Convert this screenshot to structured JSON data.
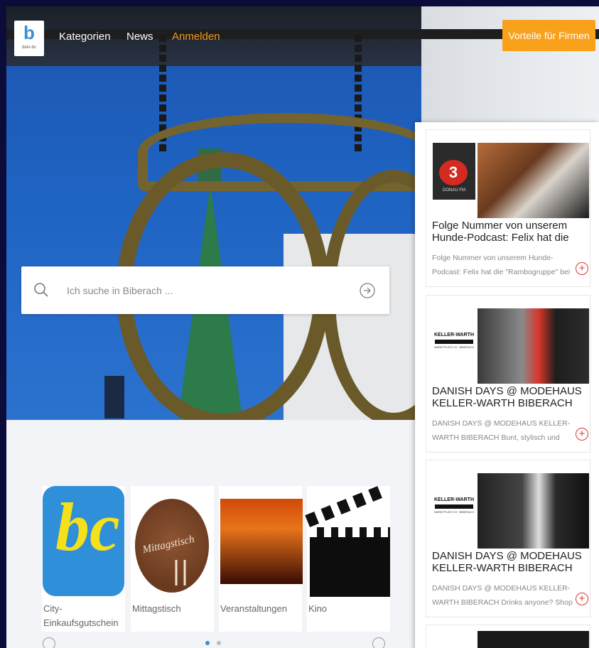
{
  "header": {
    "logo_text": "dein-bc",
    "logo_letter": "b",
    "nav": [
      {
        "label": "Kategorien"
      },
      {
        "label": "News"
      },
      {
        "label": "Anmelden"
      }
    ],
    "cta_label": "Vorteile für Firmen",
    "accent_color": "#f39a1c",
    "cta_color": "#f9a11b"
  },
  "search": {
    "placeholder": "Ich suche in Biberach ...",
    "value": ""
  },
  "categories": [
    {
      "label": "City-Einkaufsgutschein",
      "logo_text": "bc"
    },
    {
      "label": "Mittagstisch",
      "logo_text": "Mittagstisch"
    },
    {
      "label": "Veranstaltungen"
    },
    {
      "label": "Kino"
    }
  ],
  "carousel": {
    "page_count": 2,
    "active": 0
  },
  "feed": [
    {
      "title": "Folge Nummer von unserem Hunde-Podcast: Felix hat die \"Rambogruppe\" bei Stressfrei Hund",
      "desc": "Folge Nummer von unserem Hunde-Podcast: Felix hat die \"Rambogruppe\" bei Stressfrei Hund",
      "logo_text": "3",
      "logo_caption": "DONAU FM"
    },
    {
      "title": "DANISH DAYS @ MODEHAUS KELLER-WARTH BIBERACH Bunt, stylisch und modisch",
      "desc": "DANISH DAYS @ MODEHAUS KELLER-WARTH BIBERACH Bunt, stylisch und modisch",
      "logo_text": "KELLER-WARTH",
      "logo_caption": "MARKTPLATZ 15 · BIBERACH"
    },
    {
      "title": "DANISH DAYS @ MODEHAUS KELLER-WARTH BIBERACH Drinks anyone? Shop NOW",
      "desc": "DANISH DAYS @ MODEHAUS KELLER-WARTH BIBERACH Drinks anyone? Shop NOW",
      "logo_text": "KELLER-WARTH",
      "logo_caption": "MARKTPLATZ 15 · BIBERACH"
    }
  ]
}
